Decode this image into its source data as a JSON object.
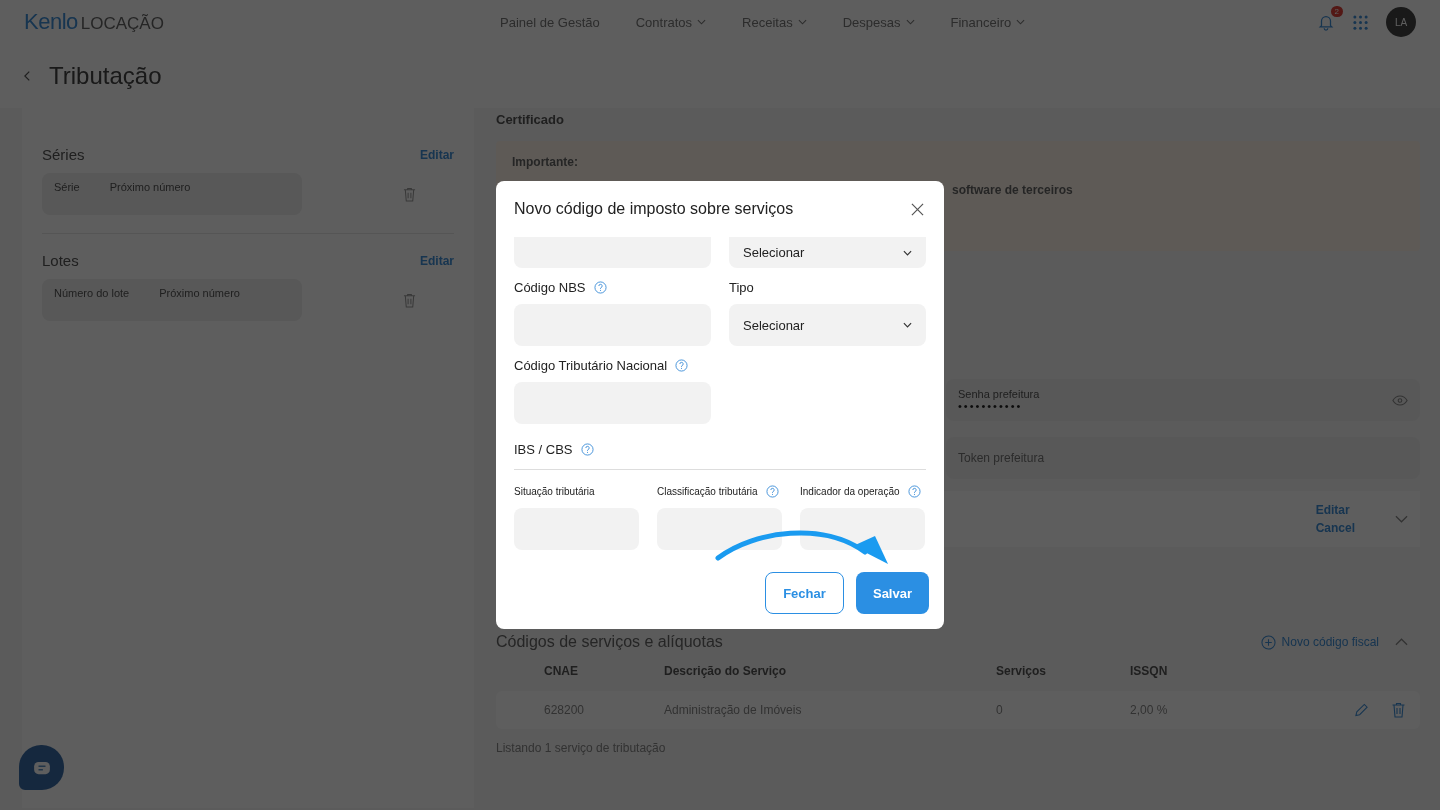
{
  "header": {
    "logo": "Kenlo",
    "logo_suffix": "LOCAÇÃO",
    "nav": [
      {
        "label": "Painel de Gestão",
        "dropdown": false
      },
      {
        "label": "Contratos",
        "dropdown": true
      },
      {
        "label": "Receitas",
        "dropdown": true
      },
      {
        "label": "Despesas",
        "dropdown": true
      },
      {
        "label": "Financeiro",
        "dropdown": true
      }
    ],
    "notifications_badge": "2",
    "avatar": "LA"
  },
  "page": {
    "title": "Tributação"
  },
  "left_panel": {
    "sections": [
      {
        "title": "Séries",
        "action": "Editar",
        "columns": [
          "Série",
          "Próximo número"
        ]
      },
      {
        "title": "Lotes",
        "action": "Editar",
        "columns": [
          "Número do lote",
          "Próximo número"
        ]
      }
    ]
  },
  "right_panel": {
    "certificate_title": "Certificado",
    "notice": {
      "title": "Importante:",
      "text": "software de terceiros"
    },
    "password_field": {
      "label": "Senha prefeitura",
      "value": "•••••••••••"
    },
    "token_field": {
      "placeholder": "Token prefeitura"
    },
    "actions": [
      "Editar",
      "Cancel"
    ],
    "services": {
      "title": "Códigos de serviços e alíquotas",
      "add_button": "Novo código fiscal",
      "columns": [
        "CNAE",
        "Descrição do Serviço",
        "Serviços",
        "ISSQN"
      ],
      "rows": [
        {
          "cells": [
            "628200",
            "Administração de Imóveis",
            "0",
            "2,00 %"
          ]
        }
      ],
      "footer": "Listando 1 serviço de tributação"
    }
  },
  "modal": {
    "title": "Novo código de imposto sobre serviços",
    "rows": [
      [
        {
          "kind": "input"
        },
        {
          "kind": "select",
          "value": "Selecionar"
        }
      ],
      [
        {
          "kind": "input",
          "label": "Código NBS",
          "help": true
        },
        {
          "kind": "select",
          "label": "Tipo",
          "help": false,
          "value": "Selecionar"
        }
      ],
      [
        {
          "kind": "input",
          "label": "Código Tributário Nacional",
          "help": true
        }
      ]
    ],
    "section": {
      "title": "IBS / CBS",
      "help": true,
      "fields": [
        {
          "label": "Situação tributária",
          "help": false
        },
        {
          "label": "Classificação tributária",
          "help": true
        },
        {
          "label": "Indicador da operação",
          "help": true
        }
      ]
    },
    "buttons": [
      {
        "label": "Fechar",
        "kind": "secondary"
      },
      {
        "label": "Salvar",
        "kind": "primary"
      }
    ]
  }
}
